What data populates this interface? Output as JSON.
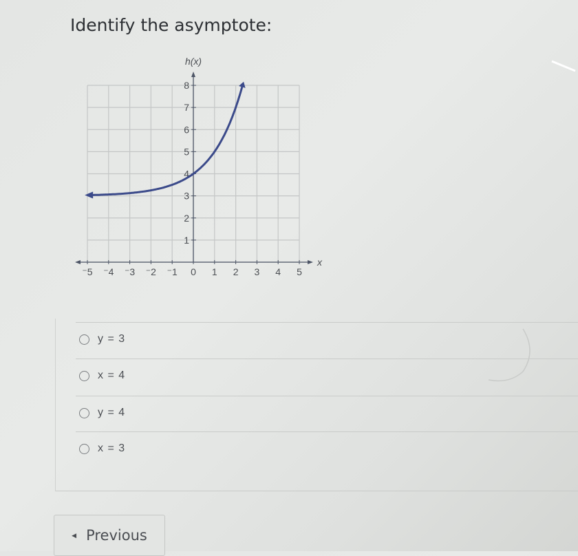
{
  "question": {
    "title": "Identify the asymptote:"
  },
  "chart_data": {
    "type": "line",
    "title": "",
    "xlabel": "x",
    "ylabel": "h(x)",
    "xlim": [
      -5,
      5
    ],
    "ylim": [
      0,
      8
    ],
    "grid": true,
    "x_ticks": [
      "-5",
      "-4",
      "-3",
      "-2",
      "-1",
      "0",
      "1",
      "2",
      "3",
      "4",
      "5"
    ],
    "y_ticks": [
      "1",
      "2",
      "3",
      "4",
      "5",
      "6",
      "7",
      "8"
    ],
    "series": [
      {
        "name": "h(x)",
        "color": "#3b4a8a",
        "description": "exponential curve approaching y=3 on the left, passing (0,4), arrow at both ends",
        "x": [
          -5,
          -4,
          -3,
          -2,
          -1,
          0,
          0.5,
          1,
          1.5,
          2,
          2.3
        ],
        "y": [
          3.03,
          3.06,
          3.12,
          3.25,
          3.5,
          4,
          4.41,
          5,
          5.83,
          7,
          7.92
        ]
      }
    ]
  },
  "options": [
    {
      "label": "y = 3",
      "selected": false
    },
    {
      "label": "x = 4",
      "selected": false
    },
    {
      "label": "y = 4",
      "selected": false
    },
    {
      "label": "x = 3",
      "selected": false
    }
  ],
  "navigation": {
    "previous_label": "Previous"
  }
}
